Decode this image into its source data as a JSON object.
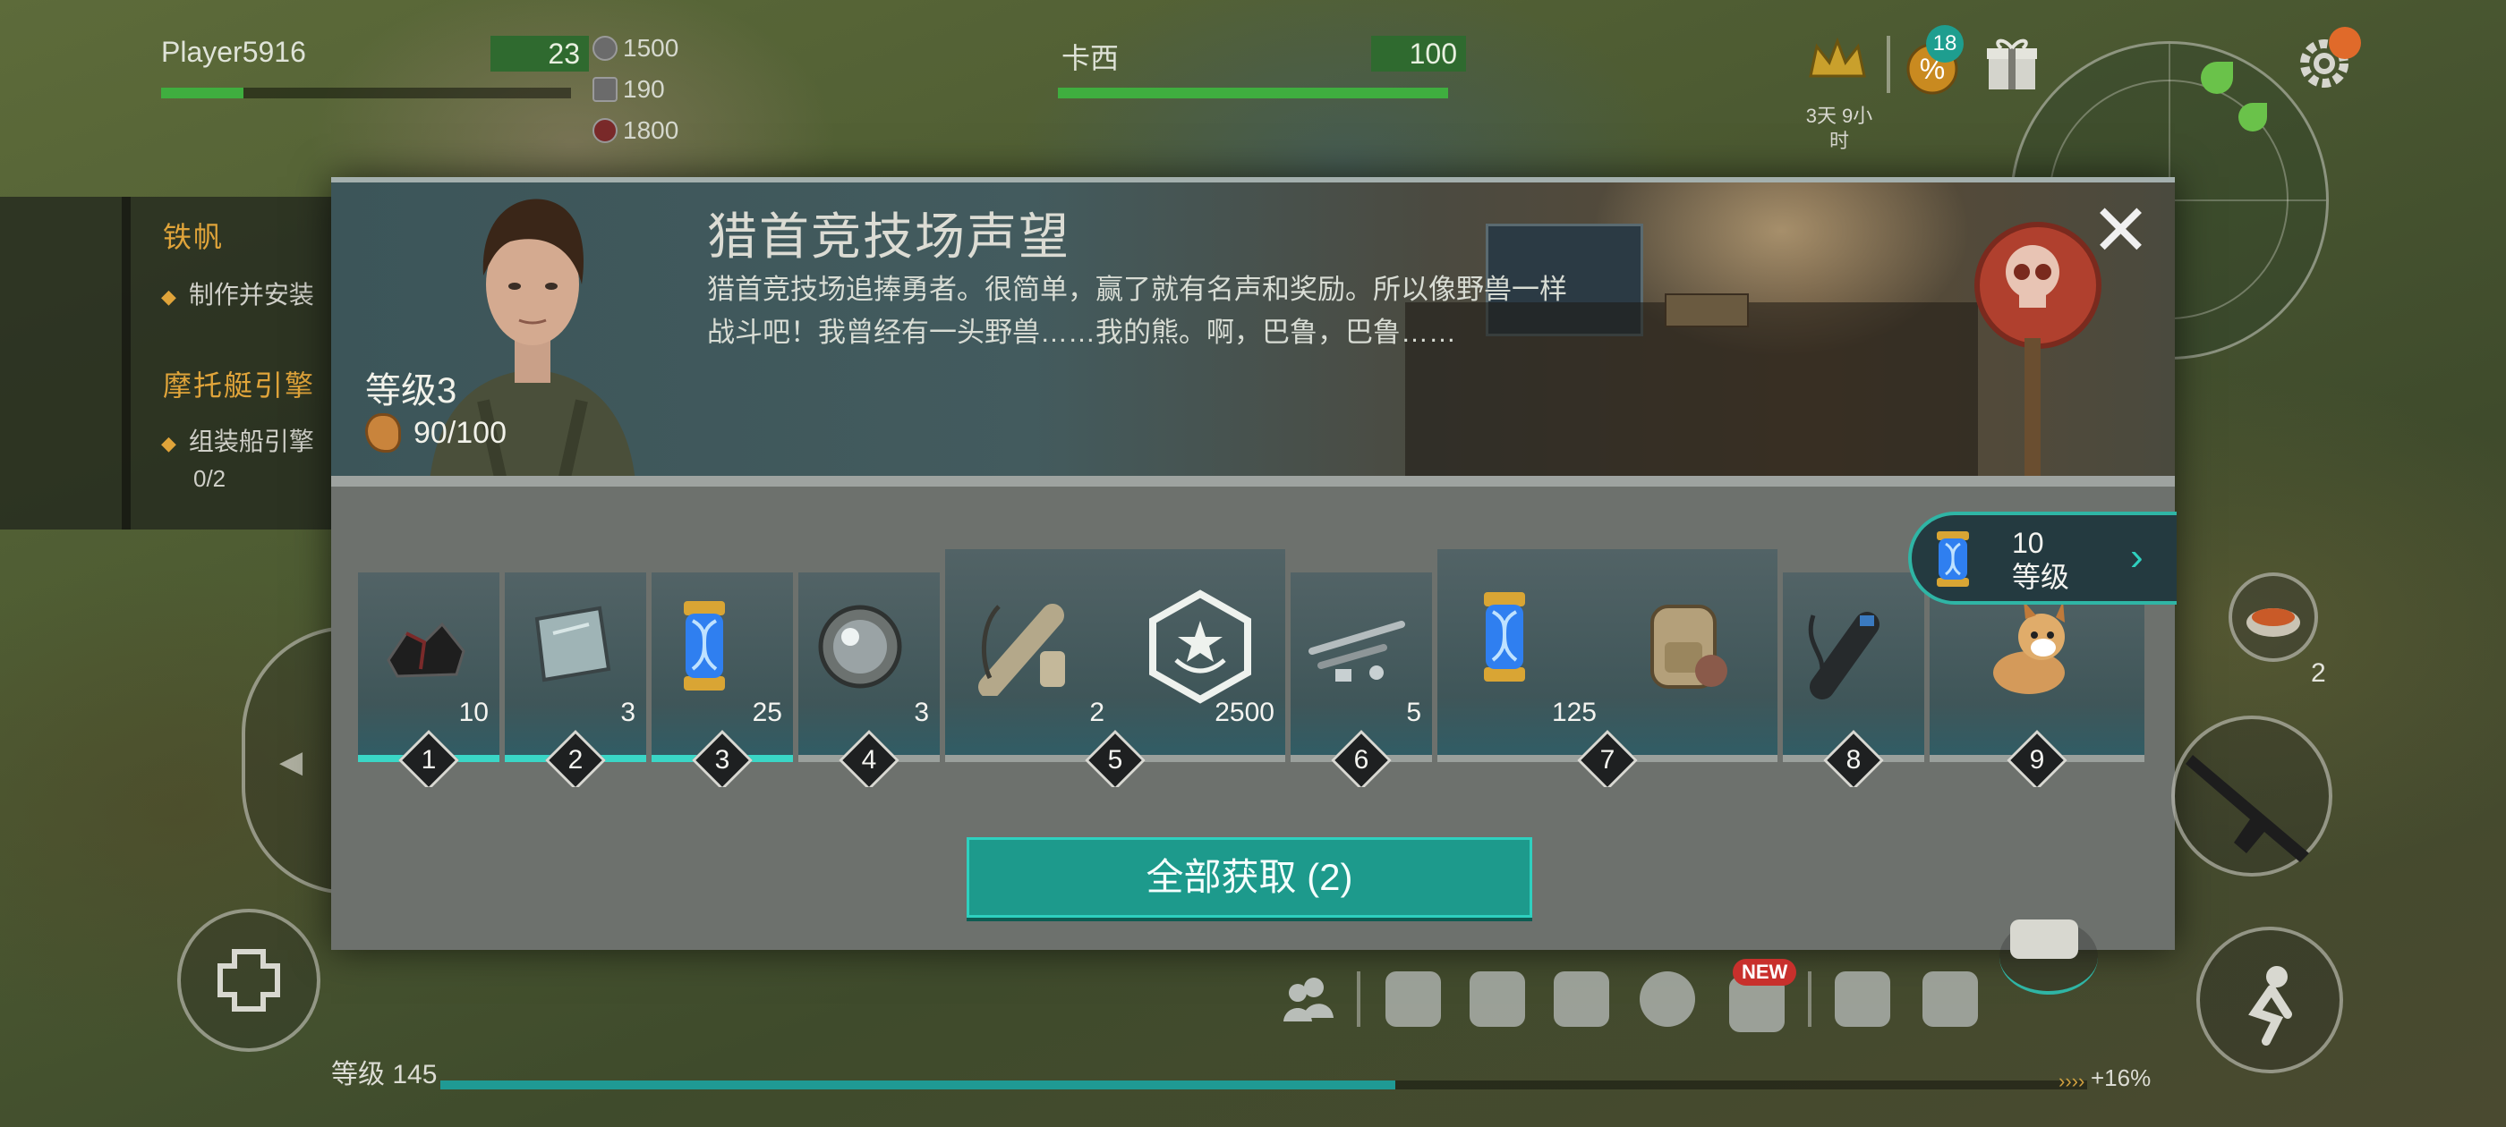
{
  "hud": {
    "player_name": "Player5916",
    "player_level": "23",
    "player_hp_fraction": 0.2,
    "resources": [
      "1500",
      "190",
      "1800"
    ],
    "companion_name": "卡西",
    "companion_value": "100",
    "companion_hp_fraction": 1.0,
    "gift_badge": "18",
    "timer_lines": [
      "3天 9小",
      "时"
    ]
  },
  "quests": {
    "q1_title": "铁帆",
    "q1_item": "制作并安装",
    "q2_title": "摩托艇引擎",
    "q2_item": "组装船引擎",
    "q2_progress": "0/2"
  },
  "modal": {
    "title": "猎首竞技场声望",
    "description": "猎首竞技场追捧勇者。很简单，赢了就有名声和奖励。所以像野兽一样战斗吧！我曾经有一头野兽……我的熊。啊，巴鲁，巴鲁……",
    "level_label": "等级3",
    "reputation": "90/100",
    "claim_button": "全部获取 (2)",
    "milestone_level": "10",
    "milestone_unit": "等级",
    "rewards": [
      {
        "tier": "1",
        "items": [
          {
            "icon": "coal-icon",
            "count": "10"
          }
        ]
      },
      {
        "tier": "2",
        "items": [
          {
            "icon": "metal-plate-icon",
            "count": "3"
          }
        ]
      },
      {
        "tier": "3",
        "items": [
          {
            "icon": "dna-capsule-icon",
            "count": "25"
          }
        ]
      },
      {
        "tier": "4",
        "items": [
          {
            "icon": "lens-icon",
            "count": "3"
          }
        ]
      },
      {
        "tier": "5",
        "items": [
          {
            "icon": "scope-icon",
            "count": "2"
          },
          {
            "icon": "reputation-badge-icon",
            "count": "2500"
          }
        ]
      },
      {
        "tier": "6",
        "items": [
          {
            "icon": "barrel-parts-icon",
            "count": "5"
          }
        ]
      },
      {
        "tier": "7",
        "items": [
          {
            "icon": "dna-capsule-icon",
            "count": "125"
          },
          {
            "icon": "backpack-icon",
            "count": ""
          }
        ]
      },
      {
        "tier": "8",
        "items": [
          {
            "icon": "silencer-icon",
            "count": ""
          }
        ]
      },
      {
        "tier": "9",
        "items": [
          {
            "icon": "dog-icon",
            "count": ""
          }
        ]
      }
    ]
  },
  "bottom": {
    "level_label": "等级 145",
    "xp_percent": "+16%",
    "food_count": "2",
    "new_badge": "NEW"
  },
  "colors": {
    "accent": "#1d9a8c",
    "quest_title": "#e0a43a",
    "hp_green": "#3fae3f"
  }
}
